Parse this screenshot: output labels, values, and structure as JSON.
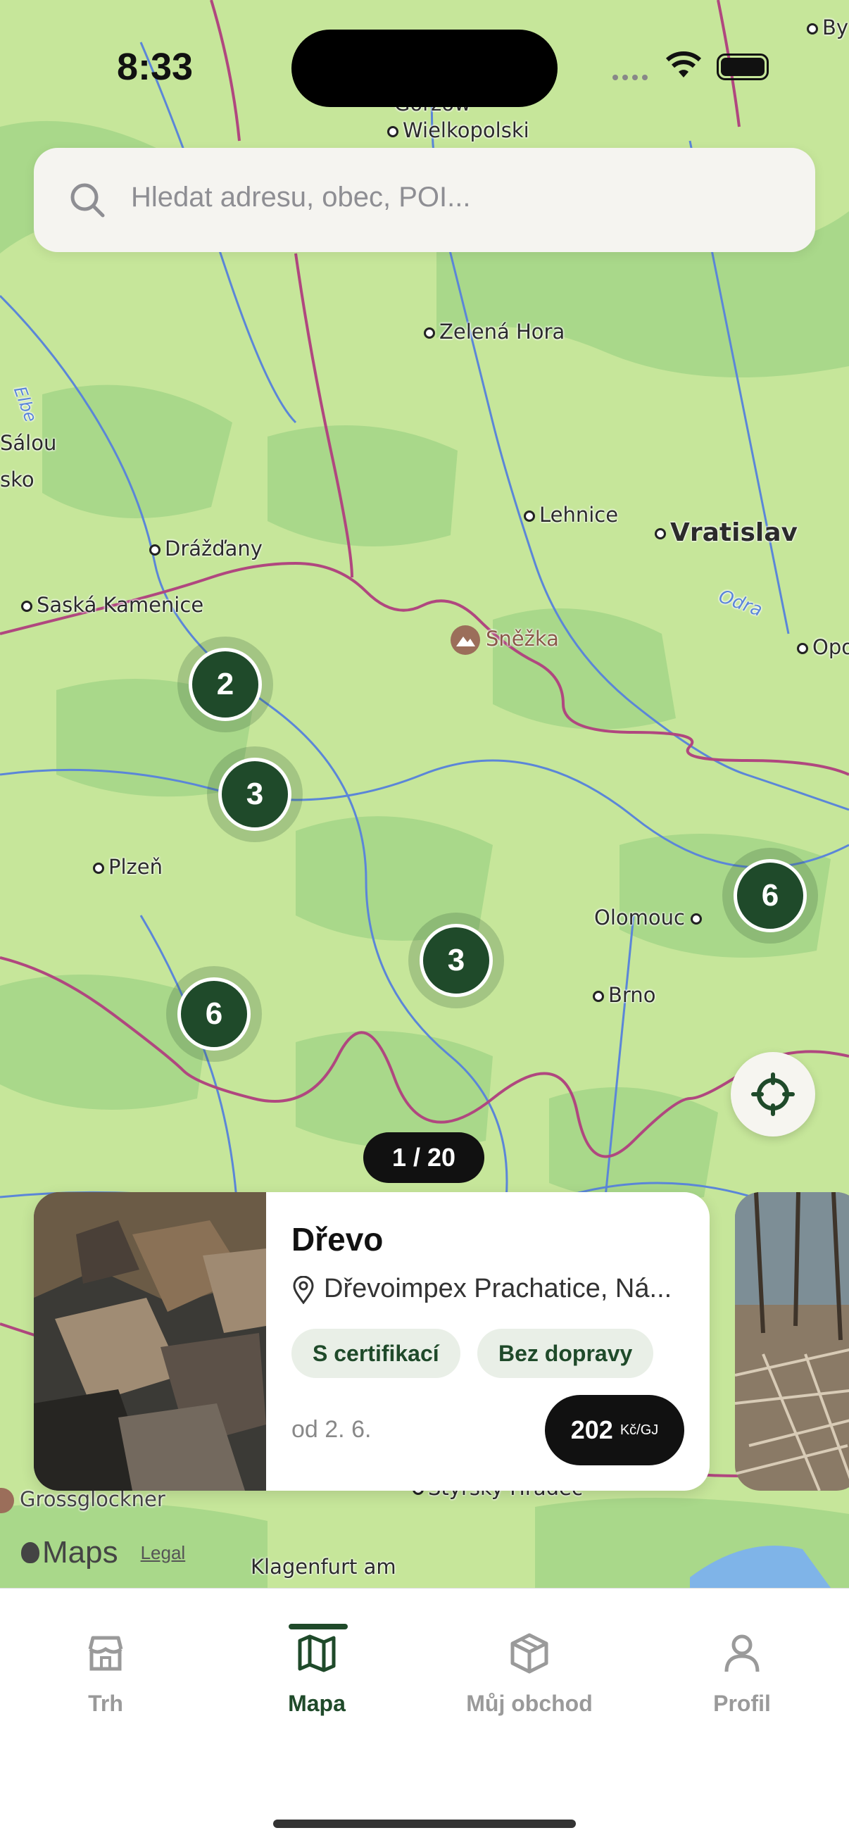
{
  "status_bar": {
    "time": "8:33"
  },
  "search": {
    "placeholder": "Hledat adresu, obec, POI..."
  },
  "map": {
    "places": [
      {
        "name": "Gorzów"
      },
      {
        "name": "Wielkopolski"
      },
      {
        "name": "By"
      },
      {
        "name": "Zelená Hora"
      },
      {
        "name": "Sálou"
      },
      {
        "name": "sko"
      },
      {
        "name": "Lehnice"
      },
      {
        "name": "Vratislav"
      },
      {
        "name": "Drážďany"
      },
      {
        "name": "Saská Kamenice"
      },
      {
        "name": "Sněžka"
      },
      {
        "name": "Opo"
      },
      {
        "name": "Odra"
      },
      {
        "name": "Elbe"
      },
      {
        "name": "Plzeň"
      },
      {
        "name": "Olomouc"
      },
      {
        "name": "Brno"
      },
      {
        "name": "Grossglockner"
      },
      {
        "name": "Štýrský Hradec"
      },
      {
        "name": "Klagenfurt am"
      }
    ],
    "clusters": [
      {
        "count": "2"
      },
      {
        "count": "3"
      },
      {
        "count": "6"
      },
      {
        "count": "3"
      },
      {
        "count": "6"
      }
    ],
    "attribution": {
      "maps": "Maps",
      "legal": "Legal"
    }
  },
  "pager": {
    "label": "1 / 20"
  },
  "listing": {
    "title": "Dřevo",
    "location": "Dřevoimpex Prachatice, Ná...",
    "tags": [
      "S certifikací",
      "Bez dopravy"
    ],
    "date": "od 2. 6.",
    "price": "202",
    "unit": "Kč/GJ"
  },
  "tabbar": {
    "tabs": [
      {
        "label": "Trh",
        "icon": "store-icon"
      },
      {
        "label": "Mapa",
        "icon": "map-icon"
      },
      {
        "label": "Můj obchod",
        "icon": "box-icon"
      },
      {
        "label": "Profil",
        "icon": "person-icon"
      }
    ],
    "active": "Mapa"
  },
  "colors": {
    "accent": "#1f4a2a",
    "map_land": "#c6e69a",
    "forest": "#a9d88a",
    "rivers": "#5b86d8",
    "borders": "#b0477f"
  }
}
